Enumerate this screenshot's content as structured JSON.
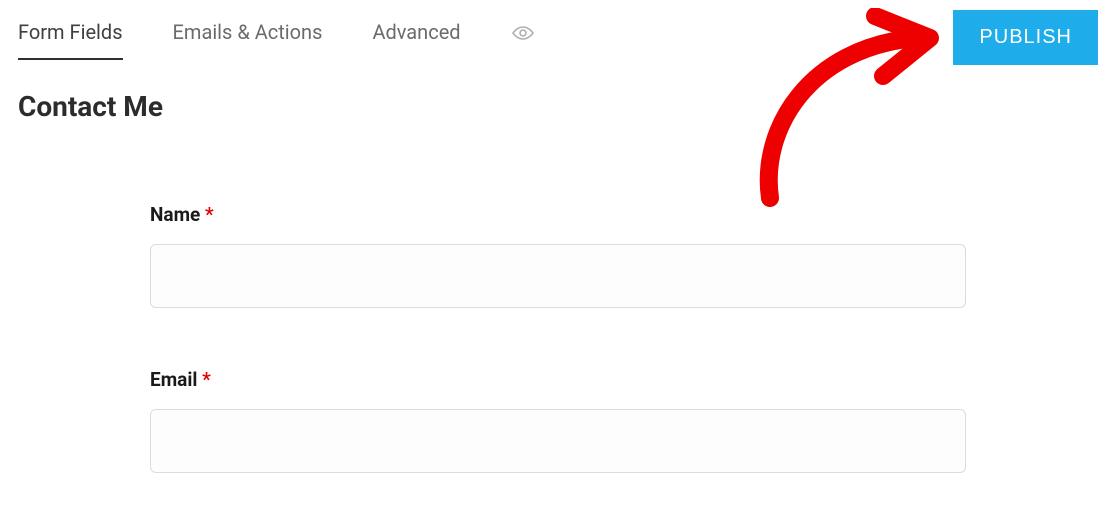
{
  "tabs": {
    "form_fields": "Form Fields",
    "emails_actions": "Emails & Actions",
    "advanced": "Advanced"
  },
  "publish_label": "PUBLISH",
  "page_title": "Contact Me",
  "form": {
    "name_label": "Name",
    "email_label": "Email",
    "required_mark": "*"
  }
}
